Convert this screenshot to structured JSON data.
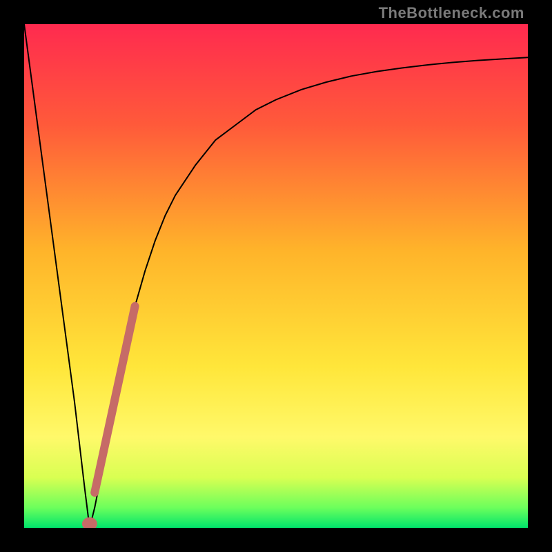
{
  "watermark": {
    "text": "TheBottleneck.com"
  },
  "chart_data": {
    "type": "line",
    "title": "",
    "xlabel": "",
    "ylabel": "",
    "xlim": [
      0,
      100
    ],
    "ylim": [
      0,
      100
    ],
    "grid": false,
    "legend": false,
    "series": [
      {
        "name": "bottleneck-curve",
        "x": [
          0,
          2,
          4,
          6,
          8,
          10,
          12,
          13,
          14,
          16,
          18,
          20,
          22,
          24,
          26,
          28,
          30,
          34,
          38,
          42,
          46,
          50,
          55,
          60,
          65,
          70,
          75,
          80,
          85,
          90,
          95,
          100
        ],
        "y": [
          100,
          85,
          70,
          55,
          40,
          25,
          8,
          0,
          4,
          14,
          25,
          35,
          44,
          51,
          57,
          62,
          66,
          72,
          77,
          80,
          83,
          85,
          87,
          88.5,
          89.7,
          90.6,
          91.3,
          91.9,
          92.4,
          92.8,
          93.1,
          93.4
        ]
      }
    ],
    "highlight": {
      "name": "highlighted-segment",
      "line": {
        "x1": 14,
        "y1": 7,
        "x2": 22,
        "y2": 44
      },
      "blob": {
        "cx": 13,
        "cy": 0.8,
        "rx": 1.5,
        "ry": 1.3
      }
    },
    "gradient": {
      "stops": [
        {
          "offset": 0.0,
          "color": "#ff2a4f"
        },
        {
          "offset": 0.2,
          "color": "#ff5a3a"
        },
        {
          "offset": 0.45,
          "color": "#ffb42a"
        },
        {
          "offset": 0.68,
          "color": "#ffe63a"
        },
        {
          "offset": 0.82,
          "color": "#fff96a"
        },
        {
          "offset": 0.9,
          "color": "#d9ff52"
        },
        {
          "offset": 0.96,
          "color": "#6cff5c"
        },
        {
          "offset": 1.0,
          "color": "#00e46b"
        }
      ]
    }
  }
}
